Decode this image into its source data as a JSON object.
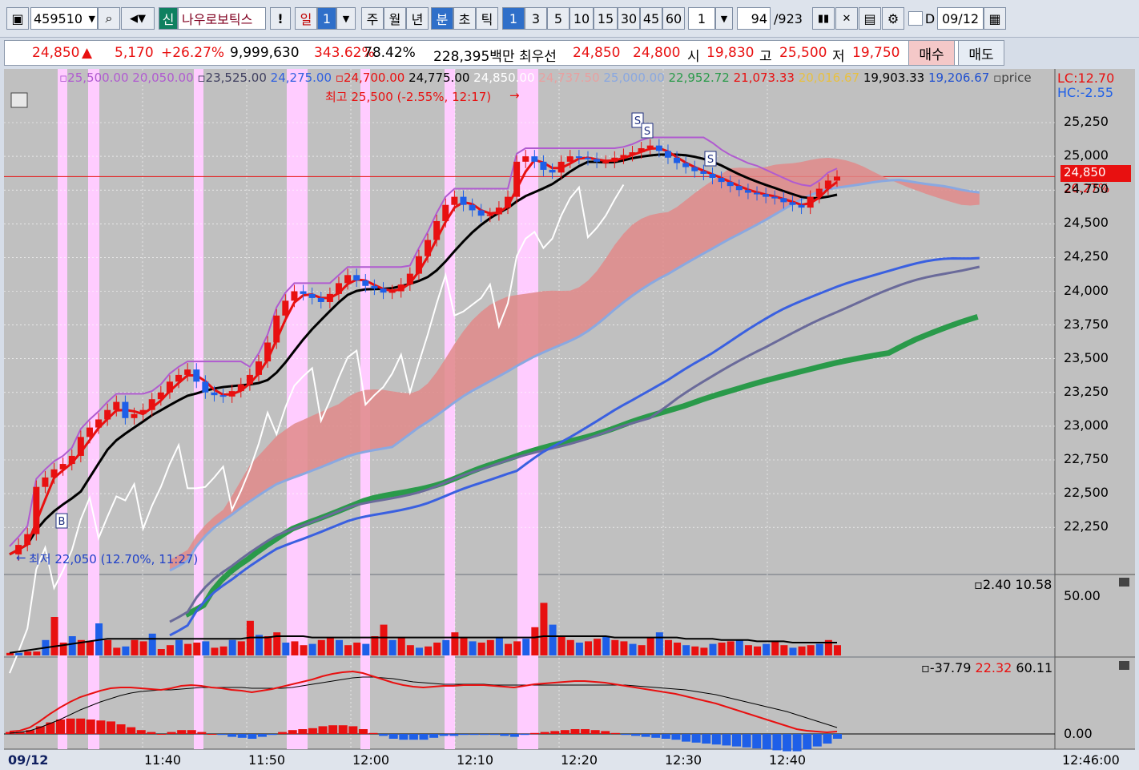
{
  "toolbar": {
    "code": "459510",
    "badge": "신",
    "name": "나우로보틱스",
    "warn": "!",
    "periods": [
      "일",
      "1",
      "주",
      "월",
      "년",
      "분",
      "초",
      "틱"
    ],
    "intervals": [
      "1",
      "3",
      "5",
      "10",
      "15",
      "30",
      "45",
      "60"
    ],
    "count": "1",
    "page": "94",
    "total": "/923",
    "d_label": "D",
    "date": "09/12"
  },
  "quote": {
    "price": "24,850",
    "arrow": "▲",
    "change": "5,170",
    "rate": "+26.27%",
    "volume": "9,999,630",
    "vol_ratio": "343.62%",
    "turnover": "78.42%",
    "amount": "228,395백만",
    "best_label": "최우선",
    "ask": "24,850",
    "bid": "24,800",
    "open_label": "시",
    "open": "19,830",
    "high_label": "고",
    "high": "25,500",
    "low_label": "저",
    "low": "19,750",
    "buy": "매수",
    "sell": "매도"
  },
  "colors": {
    "up": "#e81010",
    "down": "#1e5fe8",
    "background": "#c0c0c0",
    "cloud": "#e08a8a",
    "highlight": "#ffccff"
  },
  "chart_data": {
    "type": "line",
    "main": {
      "legend": [
        {
          "text": "25,500.00",
          "color": "#b05bd0"
        },
        {
          "text": "20,050.00",
          "color": "#b05bd0"
        },
        {
          "text": "23,525.00",
          "color": "#404060"
        },
        {
          "text": "24,275.00",
          "color": "#3060e0"
        },
        {
          "text": "24,700.00",
          "color": "#e81010"
        },
        {
          "text": "24,775.00",
          "color": "#000000"
        },
        {
          "text": "24,850.00",
          "color": "#ffffff"
        },
        {
          "text": "24,737.50",
          "color": "#e8a0a0"
        },
        {
          "text": "25,000.00",
          "color": "#8aa8e0"
        },
        {
          "text": "22,952.72",
          "color": "#2a9a4a"
        },
        {
          "text": "21,073.33",
          "color": "#e81010"
        },
        {
          "text": "20,016.67",
          "color": "#e8c040"
        },
        {
          "text": "19,903.33",
          "color": "#000000"
        },
        {
          "text": "19,206.67",
          "color": "#2050d0"
        },
        {
          "text": "price",
          "color": "#404040"
        }
      ],
      "lc": "LC:12.70",
      "hc": "HC:-2.55",
      "high_note": "최고 25,500 (-2.55%, 12:17)",
      "low_note": "최저 22,050 (12.70%, 11:27)",
      "current": "24,850",
      "current_rate": "26.27%",
      "ylim": [
        22050,
        25500
      ],
      "yticks": [
        "25,250",
        "25,000",
        "24,750",
        "24,500",
        "24,250",
        "24,000",
        "23,750",
        "23,500",
        "23,250",
        "23,000",
        "22,750",
        "22,500",
        "22,250"
      ],
      "markers": [
        "B",
        "S",
        "S",
        "S"
      ],
      "price_close": [
        22050,
        22120,
        22200,
        22550,
        22620,
        22680,
        22720,
        22780,
        22920,
        22990,
        23050,
        23120,
        23180,
        23060,
        23090,
        23120,
        23200,
        23250,
        23330,
        23380,
        23420,
        23330,
        23250,
        23230,
        23220,
        23260,
        23310,
        23380,
        23480,
        23620,
        23820,
        23930,
        24000,
        23980,
        23950,
        23920,
        23980,
        24060,
        24120,
        24080,
        24040,
        24020,
        23990,
        24000,
        24050,
        24130,
        24260,
        24380,
        24520,
        24640,
        24700,
        24640,
        24600,
        24560,
        24570,
        24620,
        24700,
        24960,
        25000,
        24960,
        24900,
        24880,
        24960,
        25000,
        24990,
        24980,
        24960,
        24960,
        24990,
        25010,
        25030,
        25060,
        25080,
        25040,
        24990,
        24950,
        24920,
        24890,
        24870,
        24840,
        24810,
        24780,
        24750,
        24730,
        24720,
        24700,
        24690,
        24660,
        24640,
        24620,
        24700,
        24760,
        24820,
        24850
      ]
    },
    "volume_panel": {
      "legend": [
        "2.40",
        "10.58"
      ],
      "ytick": "50.00",
      "values": [
        2,
        2,
        3,
        3,
        12,
        30,
        10,
        15,
        12,
        11,
        25,
        12,
        6,
        7,
        12,
        11,
        17,
        5,
        8,
        12,
        9,
        10,
        11,
        6,
        7,
        12,
        11,
        27,
        16,
        15,
        18,
        10,
        11,
        8,
        9,
        12,
        14,
        12,
        8,
        10,
        9,
        15,
        24,
        12,
        14,
        8,
        6,
        7,
        10,
        12,
        18,
        14,
        11,
        10,
        12,
        14,
        9,
        11,
        13,
        22,
        41,
        24,
        15,
        12,
        10,
        11,
        13,
        15,
        12,
        11,
        9,
        8,
        14,
        18,
        12,
        10,
        8,
        7,
        6,
        9,
        10,
        11,
        12,
        8,
        7,
        9,
        11,
        8,
        6,
        7,
        8,
        9,
        12,
        8
      ],
      "ma": [
        2,
        3,
        4,
        5,
        6,
        7,
        8,
        9,
        10,
        11,
        12,
        13,
        13,
        13,
        13,
        13,
        13,
        13,
        13,
        13,
        13,
        13,
        13,
        13,
        13,
        13,
        13,
        14,
        14,
        14,
        15,
        15,
        15,
        15,
        14,
        14,
        14,
        14,
        14,
        14,
        14,
        14,
        14,
        14,
        14,
        14,
        14,
        14,
        14,
        14,
        14,
        14,
        14,
        14,
        14,
        14,
        14,
        14,
        14,
        14,
        15,
        15,
        15,
        15,
        15,
        15,
        15,
        15,
        14,
        14,
        14,
        14,
        14,
        14,
        14,
        14,
        13,
        13,
        13,
        13,
        12,
        12,
        12,
        12,
        11,
        11,
        11,
        11,
        10,
        10,
        10,
        10,
        10,
        10
      ]
    },
    "macd_panel": {
      "legend": [
        "-37.79",
        "22.32",
        "60.11"
      ],
      "ytick": "0.00",
      "macd": [
        3,
        4,
        8,
        16,
        25,
        33,
        40,
        46,
        50,
        54,
        57,
        58,
        58,
        57,
        56,
        55,
        57,
        60,
        61,
        60,
        58,
        57,
        55,
        54,
        52,
        54,
        56,
        59,
        62,
        65,
        68,
        72,
        75,
        77,
        78,
        76,
        72,
        68,
        64,
        61,
        59,
        58,
        59,
        60,
        60,
        61,
        61,
        61,
        60,
        59,
        58,
        60,
        62,
        63,
        64,
        65,
        66,
        66,
        65,
        64,
        62,
        60,
        58,
        56,
        54,
        52,
        50,
        47,
        44,
        41,
        38,
        34,
        30,
        26,
        22,
        18,
        14,
        10,
        6,
        4,
        3,
        2,
        3
      ],
      "signal": [
        1,
        2,
        4,
        8,
        13,
        18,
        24,
        30,
        35,
        40,
        44,
        48,
        51,
        53,
        54,
        55,
        55,
        56,
        57,
        58,
        58,
        58,
        58,
        58,
        57,
        57,
        57,
        57,
        58,
        60,
        62,
        64,
        66,
        68,
        70,
        71,
        71,
        70,
        69,
        67,
        65,
        64,
        63,
        62,
        62,
        62,
        62,
        62,
        61,
        61,
        61,
        61,
        61,
        61,
        61,
        61,
        61,
        61,
        61,
        61,
        61,
        61,
        60,
        59,
        58,
        57,
        56,
        55,
        53,
        51,
        49,
        46,
        43,
        40,
        37,
        34,
        31,
        28,
        24,
        20,
        16,
        12,
        8
      ]
    },
    "xticks": [
      "09/12",
      "11:40",
      "11:50",
      "12:00",
      "12:10",
      "12:20",
      "12:30",
      "12:40"
    ],
    "time_label": "12:46:00"
  }
}
